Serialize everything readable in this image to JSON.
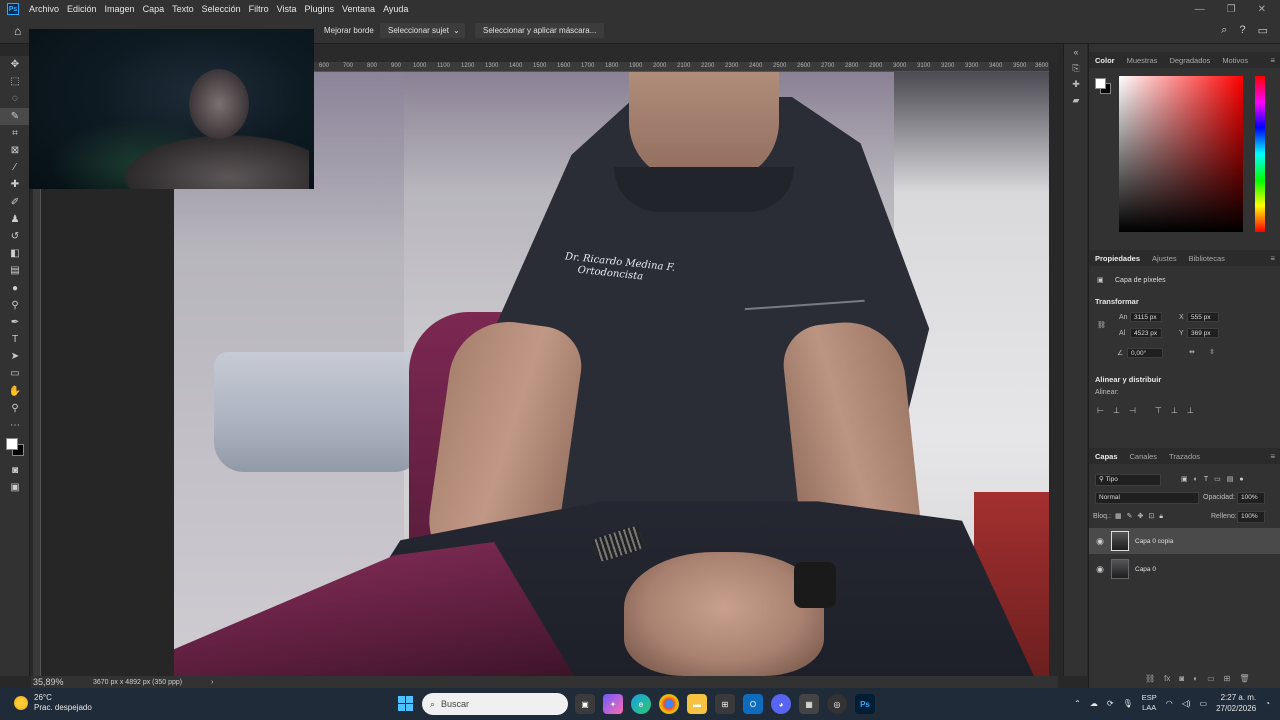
{
  "app": {
    "logo": "Ps",
    "menu": [
      "Archivo",
      "Edición",
      "Imagen",
      "Capa",
      "Texto",
      "Selección",
      "Filtro",
      "Vista",
      "Plugins",
      "Ventana",
      "Ayuda"
    ]
  },
  "options": {
    "refine_edge": "Mejorar borde",
    "select_subject": "Seleccionar sujeto",
    "select_mask": "Seleccionar y aplicar máscara..."
  },
  "ruler": {
    "ticks": [
      "600",
      "700",
      "800",
      "900",
      "1000",
      "1100",
      "1200",
      "1300",
      "1400",
      "1500",
      "1600",
      "1700",
      "1800",
      "1900",
      "2000",
      "2100",
      "2200",
      "2300",
      "2400",
      "2500",
      "2600",
      "2700",
      "2800",
      "2900",
      "3000",
      "3100",
      "3200",
      "3300",
      "3400",
      "3500",
      "3600"
    ]
  },
  "canvas": {
    "embroidery_line1": "Dr. Ricardo Medina F.",
    "embroidery_line2": "Ortodoncista"
  },
  "status": {
    "zoom": "35,89%",
    "doc_info": "3670 px x 4892 px (350 ppp)"
  },
  "color_panel": {
    "tabs": [
      "Color",
      "Muestras",
      "Degradados",
      "Motivos"
    ],
    "foreground": "#ffffff",
    "background": "#000000"
  },
  "properties": {
    "tabs": [
      "Propiedades",
      "Ajustes",
      "Bibliotecas"
    ],
    "layer_type": "Capa de píxeles",
    "transform_title": "Transformar",
    "width_label": "An",
    "width": "3115 px",
    "height_label": "Al",
    "height": "4523 px",
    "x_label": "X",
    "x": "555 px",
    "y_label": "Y",
    "y": "369 px",
    "angle": "0,00°",
    "align_title": "Alinear y distribuir",
    "align_label": "Alinear:"
  },
  "layers": {
    "tabs": [
      "Capas",
      "Canales",
      "Trazados"
    ],
    "filter": "Tipo",
    "blend_mode": "Normal",
    "opacity_label": "Opacidad:",
    "opacity": "100%",
    "lock_label": "Bloq.:",
    "fill_label": "Relleno:",
    "fill": "100%",
    "items": [
      {
        "name": "Capa 0 copia",
        "active": true
      },
      {
        "name": "Capa 0",
        "active": false
      }
    ]
  },
  "taskbar": {
    "temperature": "26°C",
    "weather": "Prac. despejado",
    "search_placeholder": "Buscar",
    "lang_line1": "ESP",
    "lang_line2": "LAA",
    "time": "2:27 a. m.",
    "date": "27/02/2026"
  }
}
